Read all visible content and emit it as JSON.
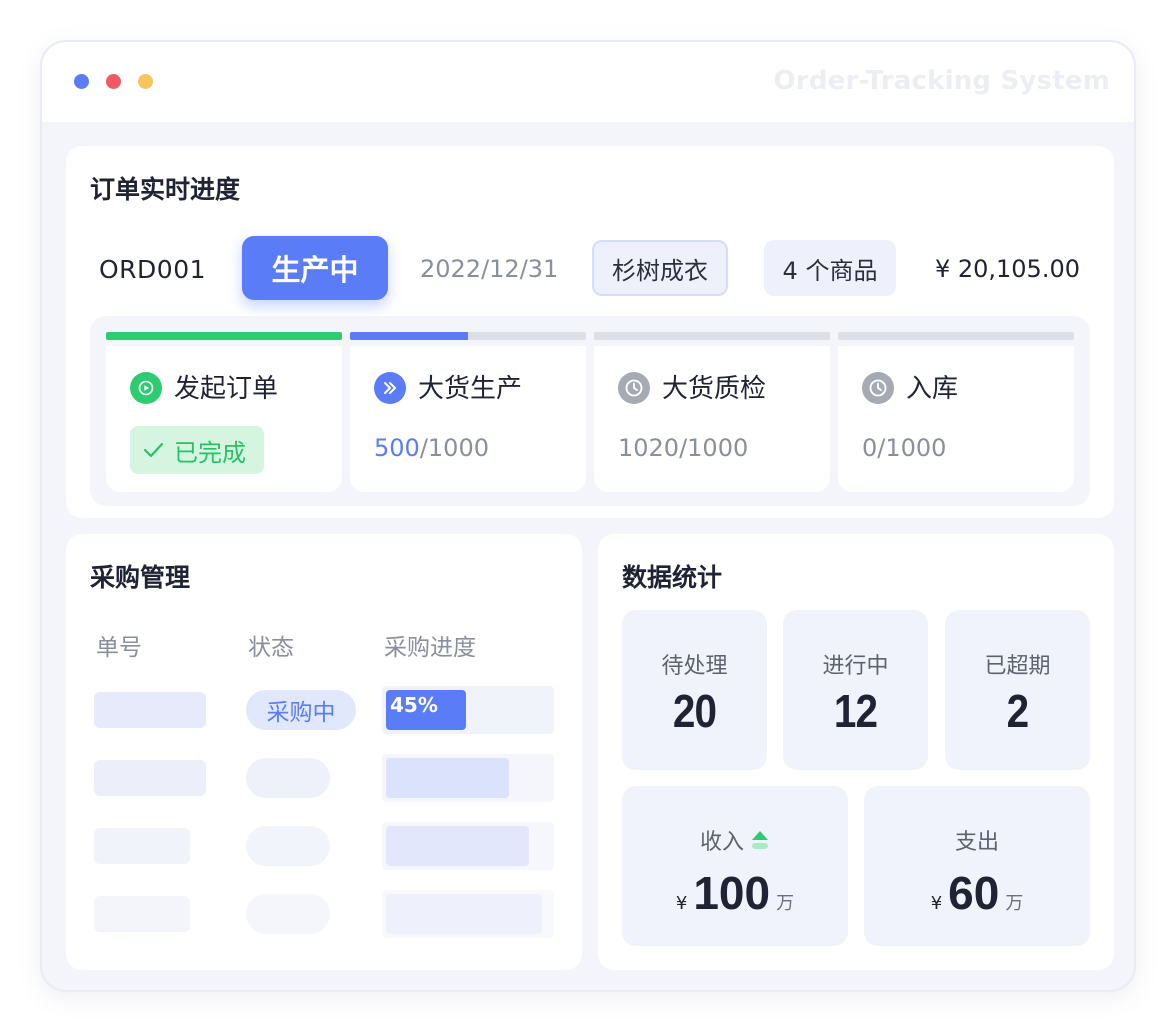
{
  "window": {
    "app_title": "Order-Tracking System"
  },
  "order": {
    "section_title": "订单实时进度",
    "id": "ORD001",
    "status": "生产中",
    "date": "2022/12/31",
    "fabric": "杉树成衣",
    "goods_count": "4 个商品",
    "amount": "¥ 20,105.00",
    "stages": [
      {
        "name": "发起订单",
        "icon": "play-icon",
        "state": "done",
        "done_label": "已完成",
        "bar_fill": 1.0,
        "bar_color": "#2ecc71"
      },
      {
        "name": "大货生产",
        "icon": "double-chevron-right-icon",
        "state": "in-progress",
        "current": "500",
        "total": "/1000",
        "bar_fill": 0.5,
        "bar_color": "#5a7cf7"
      },
      {
        "name": "大货质检",
        "icon": "clock-icon",
        "state": "pending",
        "current": "1020",
        "total": "/1000",
        "bar_fill": 0,
        "bar_color": "#dcdfe6"
      },
      {
        "name": "入库",
        "icon": "clock-icon",
        "state": "pending",
        "current": "0",
        "total": "/1000",
        "bar_fill": 0,
        "bar_color": "#dcdfe6"
      }
    ]
  },
  "purchase": {
    "section_title": "采购管理",
    "columns": [
      "单号",
      "状态",
      "采购进度"
    ],
    "first_row": {
      "status": "采购中",
      "progress_label": "45%",
      "progress": 0.45
    },
    "placeholder_progress": [
      0.75,
      0.87,
      0.95
    ]
  },
  "stats": {
    "section_title": "数据统计",
    "tiles": [
      {
        "label": "待处理",
        "value": "20"
      },
      {
        "label": "进行中",
        "value": "12"
      },
      {
        "label": "已超期",
        "value": "2"
      }
    ],
    "income": {
      "label": "收入",
      "currency": "¥",
      "value": "100",
      "unit": "万",
      "trend": "up-arrow-icon"
    },
    "expense": {
      "label": "支出",
      "currency": "¥",
      "value": "60",
      "unit": "万"
    }
  },
  "colors": {
    "accent": "#5a7cf7",
    "success": "#2ecc71",
    "muted": "#dcdfe6"
  }
}
